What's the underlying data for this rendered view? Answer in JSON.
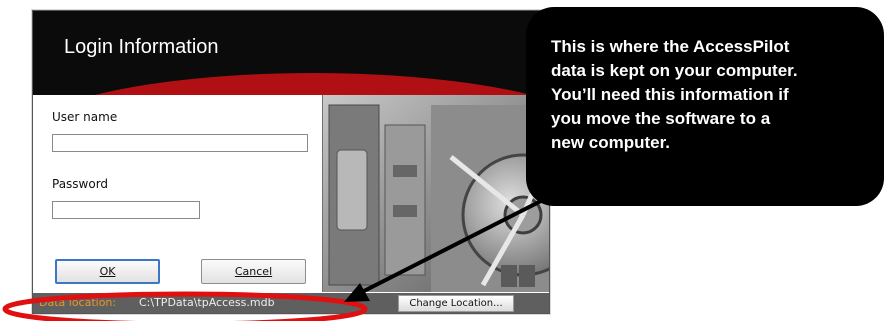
{
  "dialog": {
    "title": "Login Information",
    "username_label": "User name",
    "username_value": "",
    "password_label": "Password",
    "password_value": "",
    "ok_label": "OK",
    "cancel_label": "Cancel",
    "data_location_label": "Data location:",
    "data_location_value": "C:\\TPData\\tpAccess.mdb",
    "change_location_label": "Change Location..."
  },
  "callout": {
    "text": "This is where the AccessPilot\ndata is kept on your computer.\nYou’ll need this information if\nyou move the software to a\nnew computer."
  },
  "colors": {
    "header_bg": "#0b0b0b",
    "accent_red": "#b00f14",
    "highlight_ring": "#e01010",
    "status_bar": "#5f5f5f",
    "data_label_orange": "#e6962a",
    "callout_bg": "#000000"
  }
}
